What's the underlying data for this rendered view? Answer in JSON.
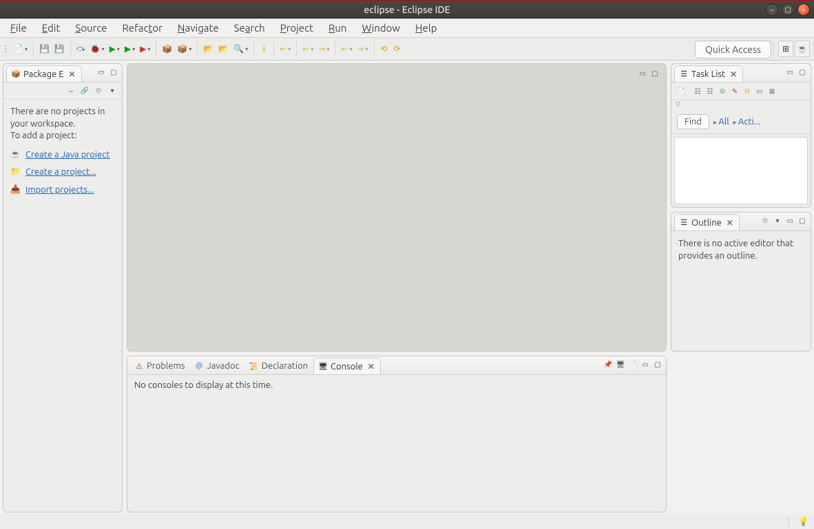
{
  "window": {
    "title": "eclipse - Eclipse IDE"
  },
  "menu": [
    "File",
    "Edit",
    "Source",
    "Refactor",
    "Navigate",
    "Search",
    "Project",
    "Run",
    "Window",
    "Help"
  ],
  "toolbar": {
    "quick_access": "Quick Access"
  },
  "package_explorer": {
    "tab_label": "Package E",
    "empty_text": "There are no projects in your workspace.\nTo add a project:",
    "links": [
      "Create a Java project",
      "Create a project...",
      "Import projects..."
    ]
  },
  "tasklist": {
    "tab_label": "Task List",
    "find": "Find",
    "filters": [
      "All",
      "Acti..."
    ]
  },
  "outline": {
    "tab_label": "Outline",
    "empty_text": "There is no active editor that provides an outline."
  },
  "bottom": {
    "tabs": [
      "Problems",
      "Javadoc",
      "Declaration",
      "Console"
    ],
    "active_tab": 3,
    "empty_text": "No consoles to display at this time."
  }
}
